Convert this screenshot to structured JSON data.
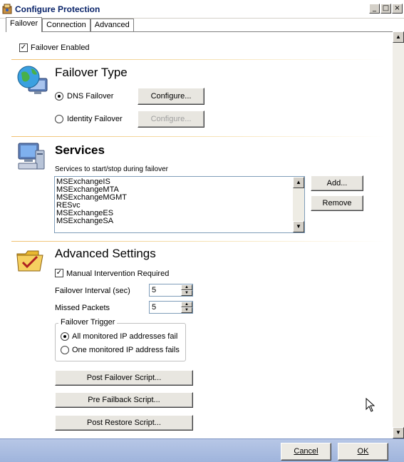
{
  "window": {
    "title": "Configure Protection"
  },
  "tabs": [
    {
      "label": "Failover",
      "active": true
    },
    {
      "label": "Connection",
      "active": false
    },
    {
      "label": "Advanced",
      "active": false
    }
  ],
  "failover_enabled": {
    "label": "Failover Enabled",
    "checked": true
  },
  "failover_type": {
    "heading": "Failover Type",
    "icon": "globe-computer-icon",
    "options": [
      {
        "label": "DNS Failover",
        "selected": true,
        "button": "Configure...",
        "button_enabled": true
      },
      {
        "label": "Identity Failover",
        "selected": false,
        "button": "Configure...",
        "button_enabled": false
      }
    ]
  },
  "services": {
    "heading": "Services",
    "icon": "computer-icon",
    "list_label": "Services to start/stop during failover",
    "items": [
      "MSExchangeIS",
      "MSExchangeMTA",
      "MSExchangeMGMT",
      "RESvc",
      "MSExchangeES",
      "MSExchangeSA"
    ],
    "add_button": "Add...",
    "remove_button": "Remove"
  },
  "advanced": {
    "heading": "Advanced Settings",
    "icon": "folder-check-icon",
    "manual_intervention": {
      "label": "Manual Intervention Required",
      "checked": true
    },
    "failover_interval": {
      "label": "Failover Interval (sec)",
      "value": "5"
    },
    "missed_packets": {
      "label": "Missed Packets",
      "value": "5"
    },
    "trigger": {
      "legend": "Failover Trigger",
      "options": [
        {
          "label": "All monitored IP addresses fail",
          "selected": true
        },
        {
          "label": "One monitored IP address fails",
          "selected": false
        }
      ]
    },
    "scripts": {
      "post_failover": "Post Failover Script...",
      "pre_failback": "Pre Failback Script...",
      "post_restore": "Post Restore Script..."
    }
  },
  "footer": {
    "cancel": "Cancel",
    "ok": "OK"
  },
  "colors": {
    "accent_separator": "#f0c070",
    "footer_bar": "#a8bbe0",
    "title_text": "#0a246a"
  }
}
